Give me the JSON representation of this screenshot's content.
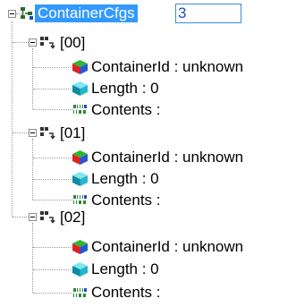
{
  "tree": {
    "root": {
      "label": "ContainerCfgs",
      "edit_value": "3",
      "icon": "tree-structure-icon"
    },
    "groups": [
      {
        "label": "[00]",
        "icon": "array-element-icon",
        "children": [
          {
            "label": "ContainerId : unknown",
            "icon": "multicolor-cube-icon"
          },
          {
            "label": "Length : 0",
            "icon": "cyan-cube-icon"
          },
          {
            "label": "Contents :",
            "icon": "binary-data-icon"
          }
        ]
      },
      {
        "label": "[01]",
        "icon": "array-element-icon",
        "children": [
          {
            "label": "ContainerId : unknown",
            "icon": "multicolor-cube-icon"
          },
          {
            "label": "Length : 0",
            "icon": "cyan-cube-icon"
          },
          {
            "label": "Contents :",
            "icon": "binary-data-icon"
          }
        ]
      },
      {
        "label": "[02]",
        "icon": "array-element-icon",
        "children": [
          {
            "label": "ContainerId : unknown",
            "icon": "multicolor-cube-icon"
          },
          {
            "label": "Length : 0",
            "icon": "cyan-cube-icon"
          },
          {
            "label": "Contents :",
            "icon": "binary-data-icon"
          }
        ]
      }
    ]
  },
  "colors": {
    "selection": "#3399ff",
    "tree_lines": "#9a9a9a",
    "edit_border": "#3c8ad8"
  }
}
